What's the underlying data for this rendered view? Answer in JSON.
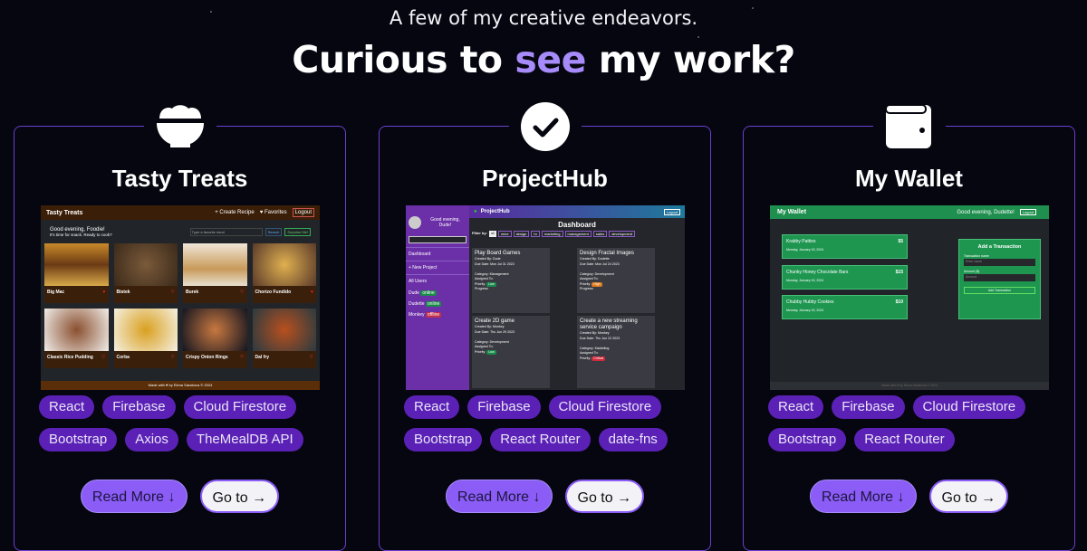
{
  "header": {
    "subtitle": "A few of my creative endeavors.",
    "title_pre": "Curious to",
    "title_accent": "see",
    "title_post": "my work?"
  },
  "colors": {
    "background": "#05060f",
    "accent": "#a78bfa",
    "tag_bg": "#5b21b6",
    "card_border": "#6d3fd0"
  },
  "buttons": {
    "read_more": "Read More ↓",
    "go_to": "Go to →"
  },
  "projects": [
    {
      "title": "Tasty Treats",
      "icon": "food-bowl-icon",
      "tags": [
        "React",
        "Firebase",
        "Cloud Firestore",
        "Bootstrap",
        "Axios",
        "TheMealDB API"
      ],
      "preview": {
        "app": "Tasty Treats",
        "nav": [
          "+ Create Recipe",
          "♥ Favorites",
          "Logout"
        ],
        "greeting": "Good evening, Foodie!",
        "prompt": "It's time for snack. Ready to cook?",
        "search_placeholder": "Type a favorite meal",
        "search": "Search",
        "surprise": "Surprise Me!",
        "recipes": [
          "Big Mac",
          "Bistek",
          "Burek",
          "Chorizo Fundido",
          "Classic Rice Pudding",
          "Corba",
          "Crispy Onion Rings",
          "Dal fry"
        ],
        "footer": "Made with ♥ by Elena Sarabova © 2024"
      }
    },
    {
      "title": "ProjectHub",
      "icon": "checkmark-icon",
      "tags": [
        "React",
        "Firebase",
        "Cloud Firestore",
        "Bootstrap",
        "React Router",
        "date-fns"
      ],
      "preview": {
        "app": "ProjectHub",
        "greeting": "Good evening, Dude!",
        "logout": "Logout",
        "dashboard": "Dashboard",
        "side_links": [
          "Dashboard",
          "+ New Project",
          "All Users"
        ],
        "users": [
          {
            "name": "Dude",
            "status": "online"
          },
          {
            "name": "Dudette",
            "status": "online"
          },
          {
            "name": "Monkey",
            "status": "offline"
          }
        ],
        "filter_label": "Filter by:",
        "filters": [
          "all",
          "mine",
          "design",
          "hr",
          "marketing",
          "management",
          "sales",
          "development"
        ],
        "tasks": [
          {
            "title": "Play Board Games",
            "created": "Created By: Dude",
            "due": "Due Date: Mon Jul 31 2023",
            "category": "Category: Management",
            "priority": "Low"
          },
          {
            "title": "Design Fractal Images",
            "created": "Created By: Dudette",
            "due": "Due Date: Mon Jul 24 2023",
            "category": "Category: Development",
            "priority": "High"
          },
          {
            "title": "Create 2D game",
            "created": "Created By: Monkey",
            "due": "Due Date: Thu Jun 29 2023",
            "category": "Category: Development",
            "priority": "Low"
          },
          {
            "title": "Create a new streaming service campaign",
            "created": "Created By: Monkey",
            "due": "Due Date: Thu Jun 22 2023",
            "category": "Category: Marketing",
            "priority": "Critical"
          }
        ],
        "assigned": "Assigned To:",
        "priority_label": "Priority:",
        "progress_label": "Progress:"
      }
    },
    {
      "title": "My Wallet",
      "icon": "wallet-icon",
      "tags": [
        "React",
        "Firebase",
        "Cloud Firestore",
        "Bootstrap",
        "React Router"
      ],
      "preview": {
        "app": "My Wallet",
        "greeting": "Good evening, Dudette!",
        "logout": "Logout",
        "items": [
          {
            "name": "Krabby Patties",
            "amount": "$5",
            "date": "Monday, January 15, 2024"
          },
          {
            "name": "Chunky Honey Chocolate Bars",
            "amount": "$15",
            "date": "Monday, January 15, 2024"
          },
          {
            "name": "Chubby Hubby Cookies",
            "amount": "$10",
            "date": "Monday, January 15, 2024"
          }
        ],
        "form_title": "Add a Transaction",
        "name_label": "Transaction name",
        "name_placeholder": "Enter name",
        "amount_label": "Amount ($)",
        "amount_placeholder": "Amount",
        "submit": "Add Transaction",
        "footer": "Made with ♥ by Elena Sarabova © 2024"
      }
    }
  ]
}
